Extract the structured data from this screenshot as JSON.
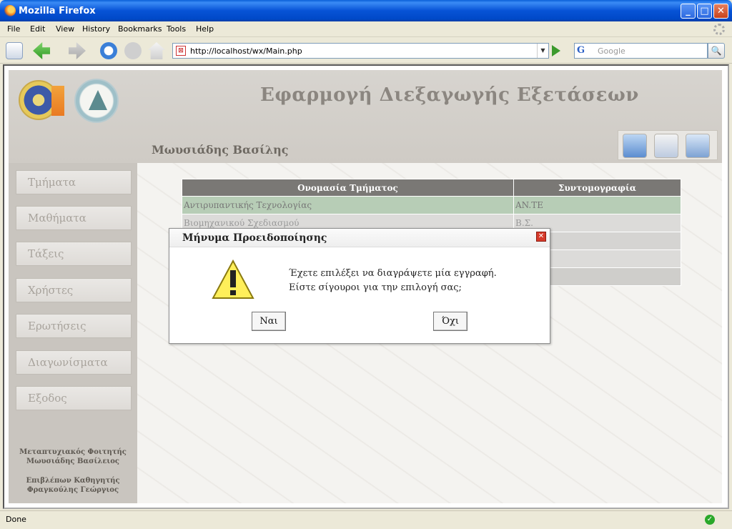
{
  "window": {
    "title": "Mozilla Firefox",
    "btn_min": "_",
    "btn_max": "□",
    "btn_close": "✕"
  },
  "menu": [
    {
      "label": "File"
    },
    {
      "label": "Edit"
    },
    {
      "label": "View"
    },
    {
      "label": "History"
    },
    {
      "label": "Bookmarks"
    },
    {
      "label": "Tools"
    },
    {
      "label": "Help"
    }
  ],
  "toolbar": {
    "url": "http://localhost/wx/Main.php",
    "url_dropdown": "▼",
    "search_logo": "G",
    "search_placeholder": "Google",
    "search_icon": "🔍"
  },
  "header": {
    "app_title": "Εφαρμογή Διεξαγωγής Εξετάσεων",
    "user_name": "Μωυσιάδης Βασίλης"
  },
  "sidebar": {
    "items": [
      {
        "label": "Τμήματα"
      },
      {
        "label": "Μαθήματα"
      },
      {
        "label": "Τάξεις"
      },
      {
        "label": "Χρήστες"
      },
      {
        "label": "Ερωτήσεις"
      },
      {
        "label": "Διαγωνίσματα"
      },
      {
        "label": "Εξοδος"
      }
    ],
    "credits_1a": "Μεταπτυχιακός Φοιτητής",
    "credits_1b": "Μωυσιάδης Βασίλειος",
    "credits_2a": "Επιβλέπων Καθηγητής",
    "credits_2b": "Φραγκούλης Γεώργιος"
  },
  "table": {
    "col1": "Ονομασία Τμήματος",
    "col2": "Συντομογραφία",
    "rows": [
      {
        "name": "Αντιρυπαντικής Τεχνολογίας",
        "abbr": "AN.TE"
      },
      {
        "name": "Βιομηχανικού Σχεδιασμού",
        "abbr": "Β.Σ."
      }
    ]
  },
  "dialog": {
    "title": "Μήνυμα Προειδοποίησης",
    "close": "✕",
    "line1": "Έχετε επιλέξει να διαγράψετε μία εγγραφή.",
    "line2": "Είστε σίγουροι για την επιλογή σας;",
    "yes": "Ναι",
    "no": "Όχι"
  },
  "status": {
    "text": "Done",
    "ok": "✓"
  }
}
